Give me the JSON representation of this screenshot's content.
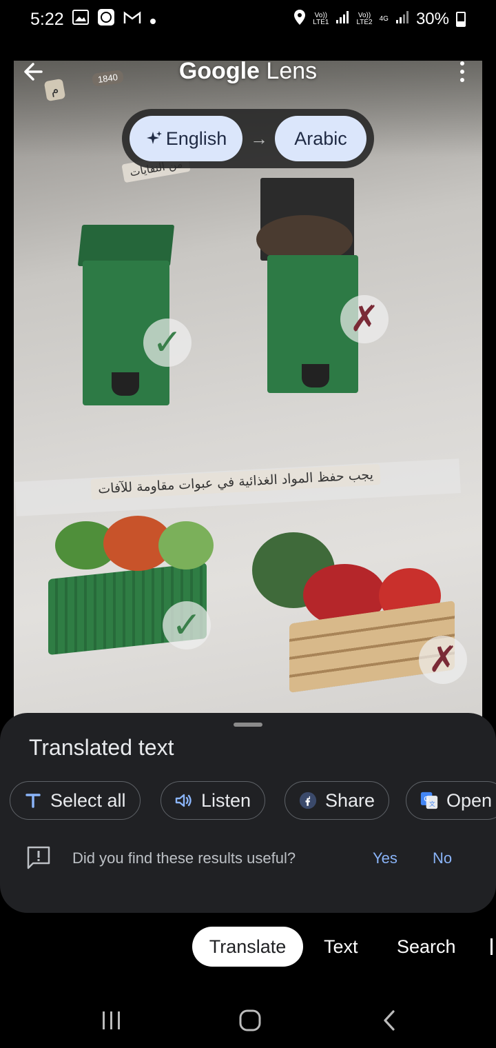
{
  "status_bar": {
    "time": "5:22",
    "icons_left": [
      "gallery-icon",
      "app-notification-icon",
      "gmail-icon",
      "dot-icon"
    ],
    "sim1": "Vo))\nLTE1",
    "sim2": "Vo))\nLTE2",
    "net": "4G",
    "battery": "30%"
  },
  "header": {
    "brand": "Google",
    "product": "Lens"
  },
  "language": {
    "source": "English",
    "arrow": "→",
    "target": "Arabic"
  },
  "photo_overlays": {
    "tag_number": "1840",
    "tag_letter": "م",
    "top_label": "من النفايات",
    "main_label": "يجب حفظ المواد الغذائية في عبوات مقاومة للآفات"
  },
  "sheet": {
    "title": "Translated text",
    "chips": [
      {
        "label": "Select all",
        "icon": "text-select-icon"
      },
      {
        "label": "Listen",
        "icon": "speaker-icon"
      },
      {
        "label": "Share",
        "icon": "share-icon"
      },
      {
        "label": "Open",
        "icon": "google-translate-icon"
      }
    ],
    "feedback": {
      "question": "Did you find these results useful?",
      "yes": "Yes",
      "no": "No"
    }
  },
  "modes": {
    "active": "Translate",
    "tabs": [
      "Translate",
      "Text",
      "Search"
    ]
  },
  "colors": {
    "accent": "#8ab4f8",
    "pill": "#dbe6fb",
    "sheet": "#202124"
  }
}
